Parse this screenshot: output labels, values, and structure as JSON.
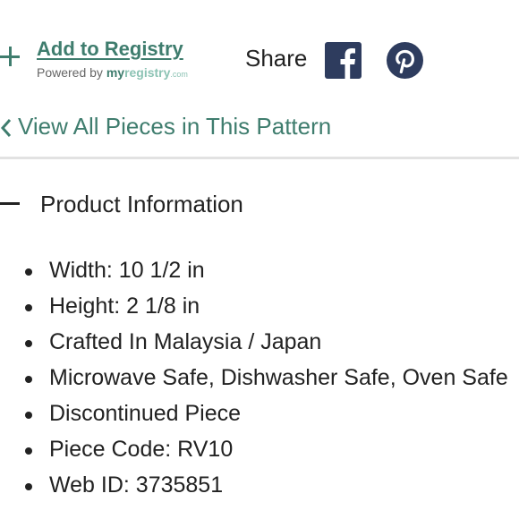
{
  "registry": {
    "add_label": "Add to Registry",
    "powered_by": "Powered by ",
    "brand_my": "my",
    "brand_registry": "registry",
    "brand_com": ".com"
  },
  "share": {
    "label": "Share",
    "facebook_icon": "facebook-icon",
    "pinterest_icon": "pinterest-icon"
  },
  "nav": {
    "back_label": "View All Pieces in This Pattern"
  },
  "product_info": {
    "title": "Product Information",
    "items": [
      "Width: 10 1/2 in",
      "Height: 2 1/8 in",
      "Crafted In Malaysia / Japan",
      "Microwave Safe, Dishwasher Safe, Oven Safe",
      "Discontinued Piece",
      "Piece Code: RV10",
      "Web ID: 3735851"
    ]
  },
  "colors": {
    "accent": "#3f7d6e",
    "brand_light": "#8cc3b4",
    "facebook_bg": "#2e3c5e",
    "pinterest_bg": "#2e3c5e",
    "text": "#222222"
  }
}
